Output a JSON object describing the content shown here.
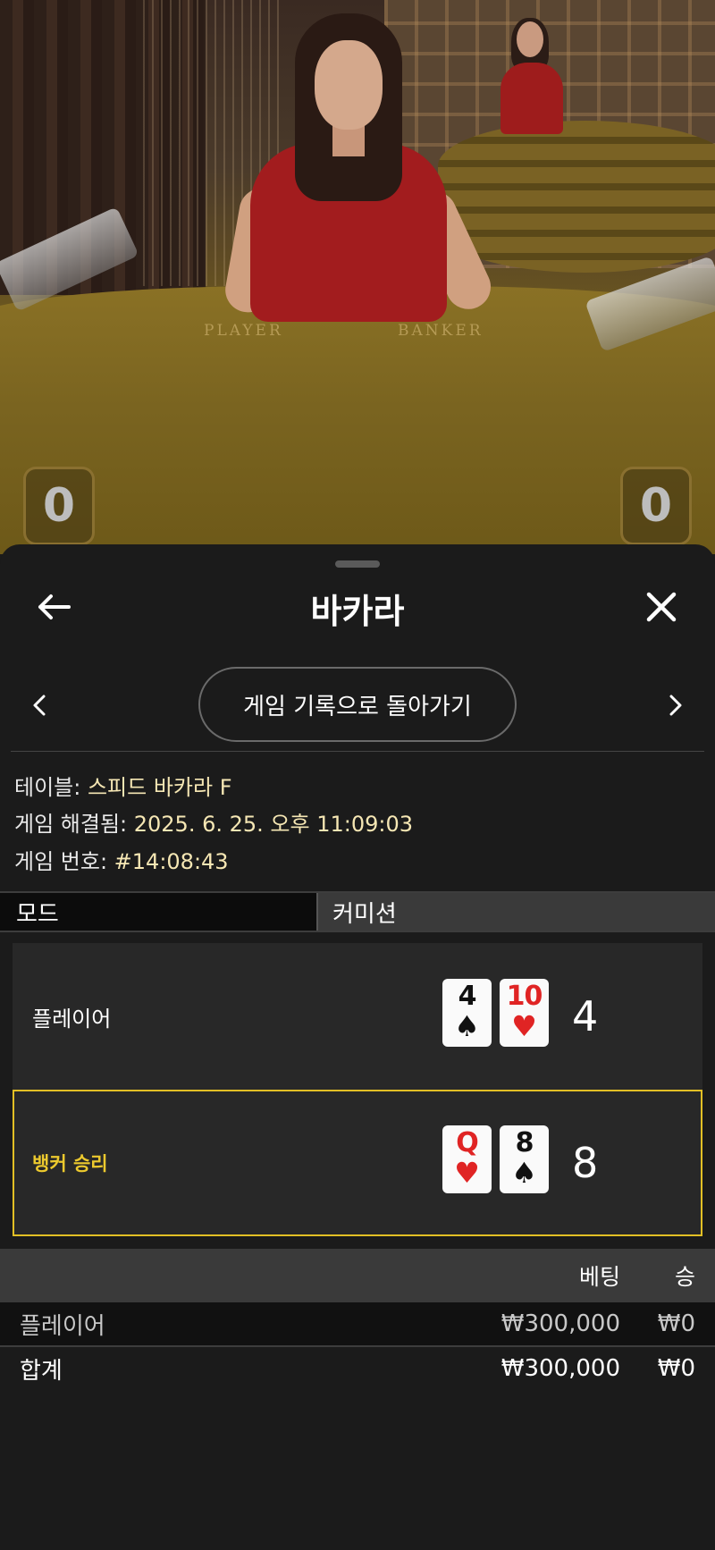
{
  "video": {
    "felt_player": "PLAYER",
    "felt_banker": "BANKER",
    "player_score": "0",
    "banker_score": "0"
  },
  "header": {
    "title": "바카라",
    "back_icon": "arrow-left-icon",
    "close_icon": "close-icon"
  },
  "nav": {
    "back_to_history": "게임 기록으로 돌아가기",
    "prev_icon": "chevron-left-icon",
    "next_icon": "chevron-right-icon"
  },
  "info": {
    "table_label": "테이블: ",
    "table_value": "스피드 바카라 F",
    "resolved_label": "게임 해결됨: ",
    "resolved_value": "2025. 6. 25. 오후 11:09:03",
    "round_label": "게임 번호: ",
    "round_value": "#14:08:43"
  },
  "tabs": {
    "mode": "모드",
    "commission": "커미션"
  },
  "hands": {
    "player": {
      "label": "플레이어",
      "cards": [
        {
          "rank": "4",
          "suit": "♠",
          "color": "black"
        },
        {
          "rank": "10",
          "suit": "♥",
          "color": "red"
        }
      ],
      "total": "4"
    },
    "banker": {
      "label": "뱅커 승리",
      "cards": [
        {
          "rank": "Q",
          "suit": "♥",
          "color": "red"
        },
        {
          "rank": "8",
          "suit": "♠",
          "color": "black"
        }
      ],
      "total": "8"
    }
  },
  "bets": {
    "header_bet": "베팅",
    "header_win": "승",
    "rows": [
      {
        "name": "플레이어",
        "bet": "₩300,000",
        "win": "₩0"
      },
      {
        "name": "합계",
        "bet": "₩300,000",
        "win": "₩0"
      }
    ]
  },
  "colors": {
    "accent_gold": "#ecc92e",
    "info_value": "#f6e7b4",
    "sheet_bg": "#1b1b1b"
  }
}
